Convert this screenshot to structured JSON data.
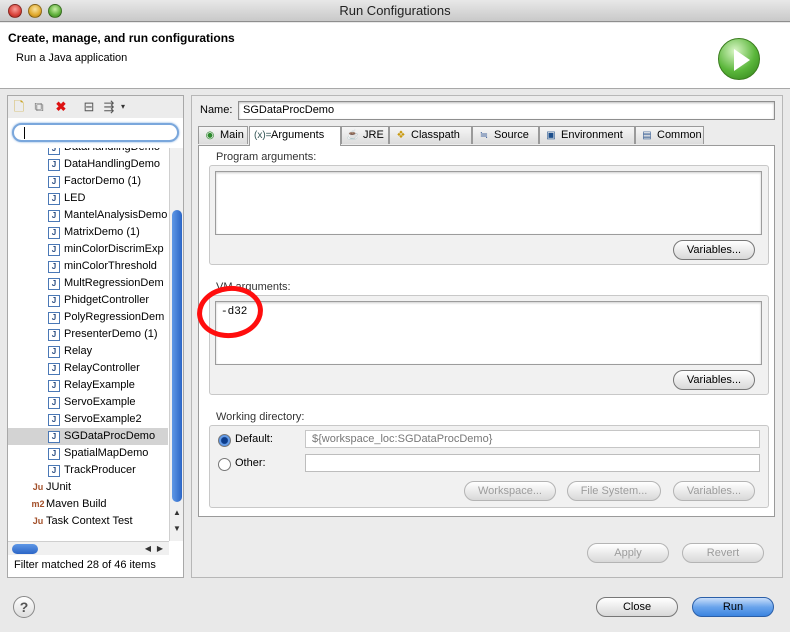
{
  "window": {
    "title": "Run Configurations"
  },
  "header": {
    "title": "Create, manage, and run configurations",
    "subtitle": "Run a Java application"
  },
  "left": {
    "items": [
      {
        "icon": "J",
        "label": "DataHandlingDemo",
        "partial": true
      },
      {
        "icon": "J",
        "label": "DataHandlingDemo"
      },
      {
        "icon": "J",
        "label": "FactorDemo (1)"
      },
      {
        "icon": "J",
        "label": "LED"
      },
      {
        "icon": "J",
        "label": "MantelAnalysisDemo"
      },
      {
        "icon": "J",
        "label": "MatrixDemo (1)"
      },
      {
        "icon": "J",
        "label": "minColorDiscrimExp"
      },
      {
        "icon": "J",
        "label": "minColorThreshold"
      },
      {
        "icon": "J",
        "label": "MultRegressionDem"
      },
      {
        "icon": "J",
        "label": "PhidgetController"
      },
      {
        "icon": "J",
        "label": "PolyRegressionDem"
      },
      {
        "icon": "J",
        "label": "PresenterDemo (1)"
      },
      {
        "icon": "J",
        "label": "Relay"
      },
      {
        "icon": "J",
        "label": "RelayController"
      },
      {
        "icon": "J",
        "label": "RelayExample"
      },
      {
        "icon": "J",
        "label": "ServoExample"
      },
      {
        "icon": "J",
        "label": "ServoExample2"
      },
      {
        "icon": "J",
        "label": "SGDataProcDemo",
        "selected": true
      },
      {
        "icon": "J",
        "label": "SpatialMapDemo"
      },
      {
        "icon": "J",
        "label": "TrackProducer"
      },
      {
        "icon": "Ju",
        "label": "JUnit",
        "top": true
      },
      {
        "icon": "m2",
        "label": "Maven Build",
        "top": true
      },
      {
        "icon": "Ju",
        "label": "Task Context Test",
        "top": true
      }
    ],
    "filter_status": "Filter matched 28 of 46 items"
  },
  "right": {
    "name_label": "Name:",
    "name_value": "SGDataProcDemo",
    "tabs": [
      "Main",
      "Arguments",
      "JRE",
      "Classpath",
      "Source",
      "Environment",
      "Common"
    ],
    "program_args_label": "Program arguments:",
    "program_args_value": "",
    "vm_args_label": "VM arguments:",
    "vm_args_value": "-d32",
    "variables_label": "Variables...",
    "working_dir_label": "Working directory:",
    "default_label": "Default:",
    "default_value": "${workspace_loc:SGDataProcDemo}",
    "other_label": "Other:",
    "workspace_btn": "Workspace...",
    "filesystem_btn": "File System...",
    "apply_btn": "Apply",
    "revert_btn": "Revert"
  },
  "footer": {
    "close_btn": "Close",
    "run_btn": "Run",
    "help": "?"
  }
}
